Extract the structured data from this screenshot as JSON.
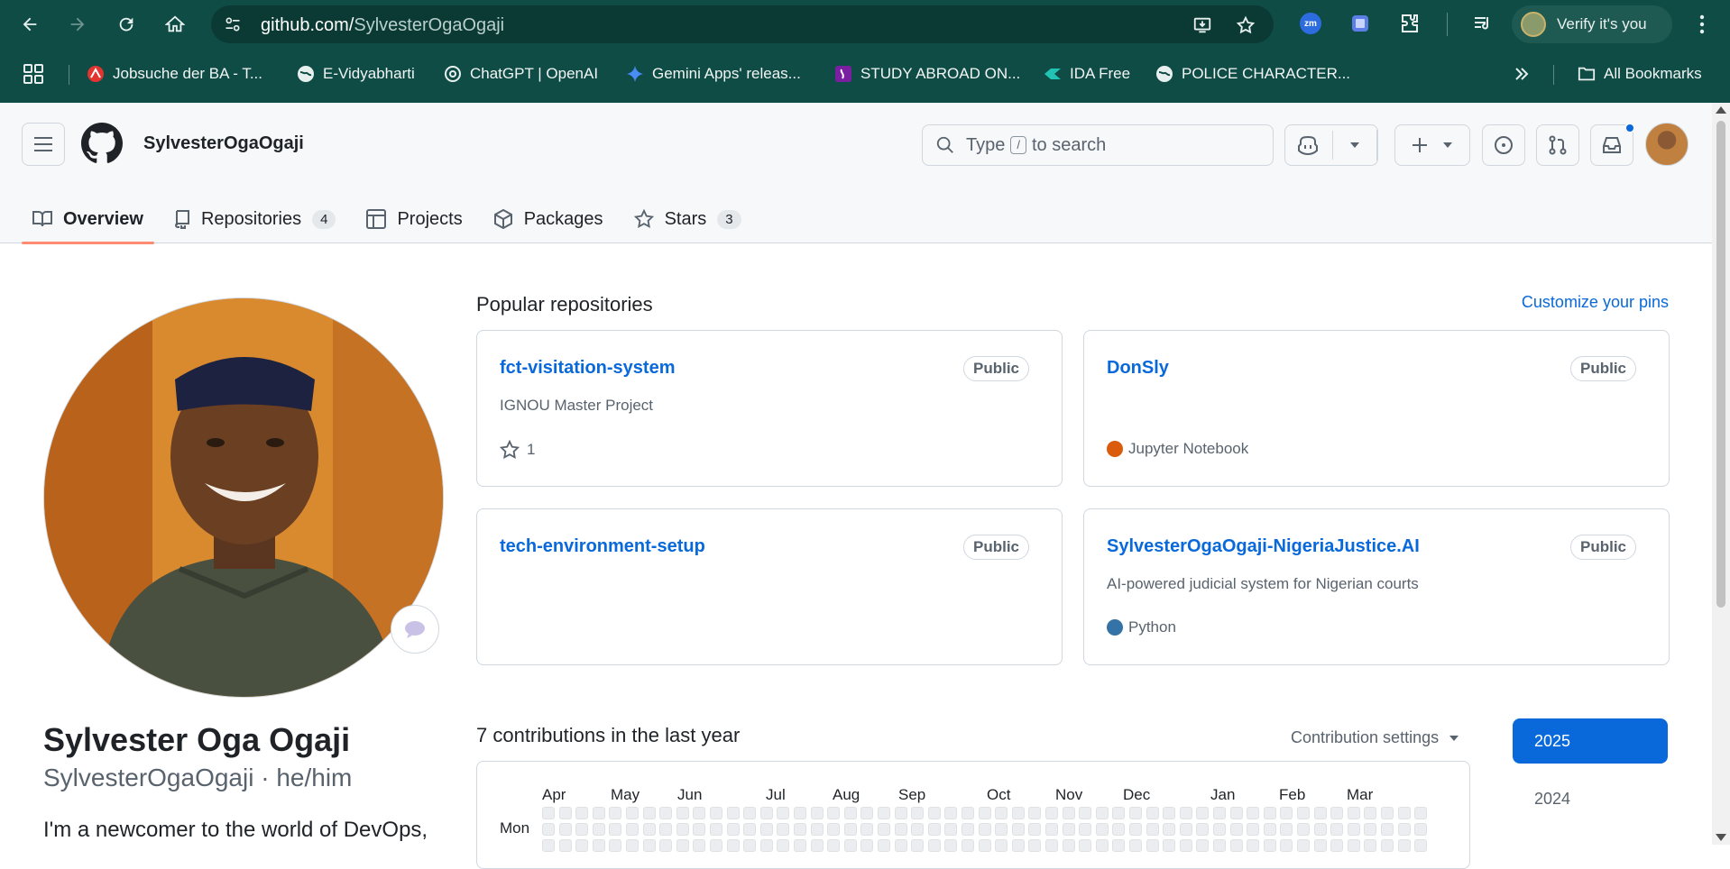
{
  "browser": {
    "url_host": "github.com/",
    "url_path": "SylvesterOgaOgaji",
    "profile_label": "Verify it's you",
    "bookmarks": [
      {
        "label": "Jobsuche der BA - T...",
        "icon": "ba-icon",
        "color": "#e3342f"
      },
      {
        "label": "E-Vidyabharti",
        "icon": "globe-icon",
        "color": "#ffffff"
      },
      {
        "label": "ChatGPT | OpenAI",
        "icon": "openai-icon",
        "color": "#ffffff"
      },
      {
        "label": "Gemini Apps' releas...",
        "icon": "gemini-icon",
        "color": "#4a8cf7"
      },
      {
        "label": "STUDY ABROAD ON...",
        "icon": "study-icon",
        "color": "#7b1fa2"
      },
      {
        "label": "IDA Free",
        "icon": "ida-icon",
        "color": "#22c3b5"
      },
      {
        "label": "POLICE CHARACTER...",
        "icon": "globe-icon",
        "color": "#ffffff"
      }
    ],
    "all_bookmarks_label": "All Bookmarks"
  },
  "header": {
    "username": "SylvesterOgaOgaji",
    "search_prefix": "Type",
    "search_key": "/",
    "search_suffix": "to search",
    "tabs": [
      {
        "label": "Overview",
        "icon": "book-icon",
        "active": true
      },
      {
        "label": "Repositories",
        "icon": "repo-icon",
        "count": "4"
      },
      {
        "label": "Projects",
        "icon": "table-icon"
      },
      {
        "label": "Packages",
        "icon": "package-icon"
      },
      {
        "label": "Stars",
        "icon": "star-icon",
        "count": "3"
      }
    ]
  },
  "profile": {
    "name": "Sylvester Oga Ogaji",
    "login_line": "SylvesterOgaOgaji · he/him",
    "bio": "I'm a newcomer to the world of DevOps,"
  },
  "popular": {
    "title": "Popular repositories",
    "customize_label": "Customize your pins",
    "repos": [
      {
        "name": "fct-visitation-system",
        "visibility": "Public",
        "description": "IGNOU Master Project",
        "stars": "1",
        "language": "",
        "lang_color": ""
      },
      {
        "name": "DonSly",
        "visibility": "Public",
        "description": "",
        "stars": "",
        "language": "Jupyter Notebook",
        "lang_color": "#DA5B0B"
      },
      {
        "name": "tech-environment-setup",
        "visibility": "Public",
        "description": "",
        "stars": "",
        "language": "",
        "lang_color": ""
      },
      {
        "name": "SylvesterOgaOgaji-NigeriaJustice.AI",
        "visibility": "Public",
        "description": "AI-powered judicial system for Nigerian courts",
        "stars": "",
        "language": "Python",
        "lang_color": "#3572A5"
      }
    ]
  },
  "contributions": {
    "title": "7 contributions in the last year",
    "settings_label": "Contribution settings",
    "months": [
      "Apr",
      "May",
      "Jun",
      "Jul",
      "Aug",
      "Sep",
      "Oct",
      "Nov",
      "Dec",
      "Jan",
      "Feb",
      "Mar"
    ],
    "day_label": "Mon",
    "years": [
      "2025",
      "2024"
    ],
    "selected_year": "2025"
  }
}
